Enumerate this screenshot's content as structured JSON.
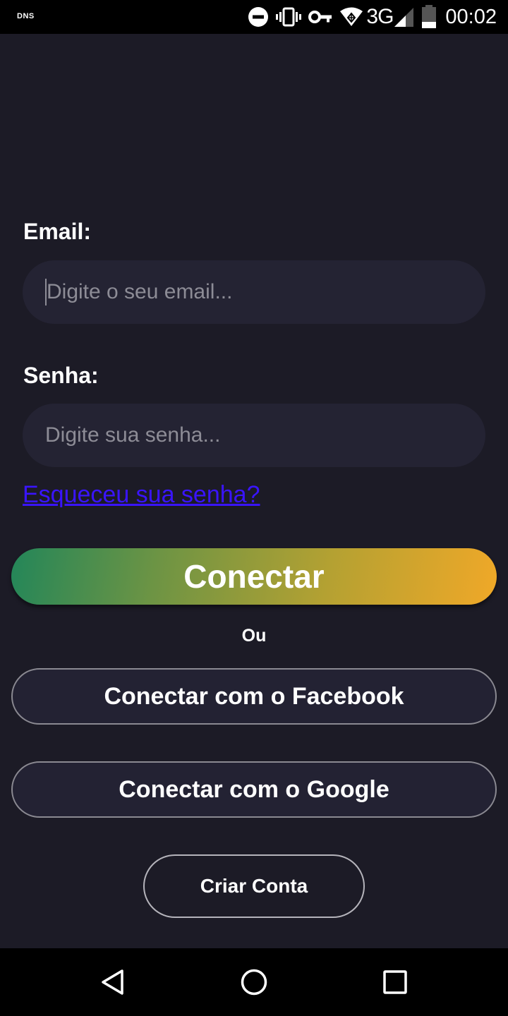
{
  "status_bar": {
    "dns_label": "DNS",
    "network": "3G",
    "time": "00:02",
    "icons": [
      "do-not-disturb-icon",
      "vibrate-icon",
      "vpn-key-icon",
      "wifi-icon",
      "signal-icon",
      "battery-icon"
    ]
  },
  "form": {
    "email_label": "Email:",
    "email_placeholder": "Digite o seu email...",
    "password_label": "Senha:",
    "password_placeholder": "Digite sua senha...",
    "forgot_link": "Esqueceu sua senha?",
    "connect_button": "Conectar",
    "or_label": "Ou",
    "facebook_button": "Conectar com o Facebook",
    "google_button": "Conectar com o Google",
    "create_account_button": "Criar Conta"
  },
  "colors": {
    "background": "#1c1b26",
    "input_background": "#242333",
    "link": "#3a14ff",
    "gradient_start": "#238659",
    "gradient_end": "#f0a828"
  },
  "nav_bar": {
    "icons": [
      "back-icon",
      "home-icon",
      "recents-icon"
    ]
  }
}
